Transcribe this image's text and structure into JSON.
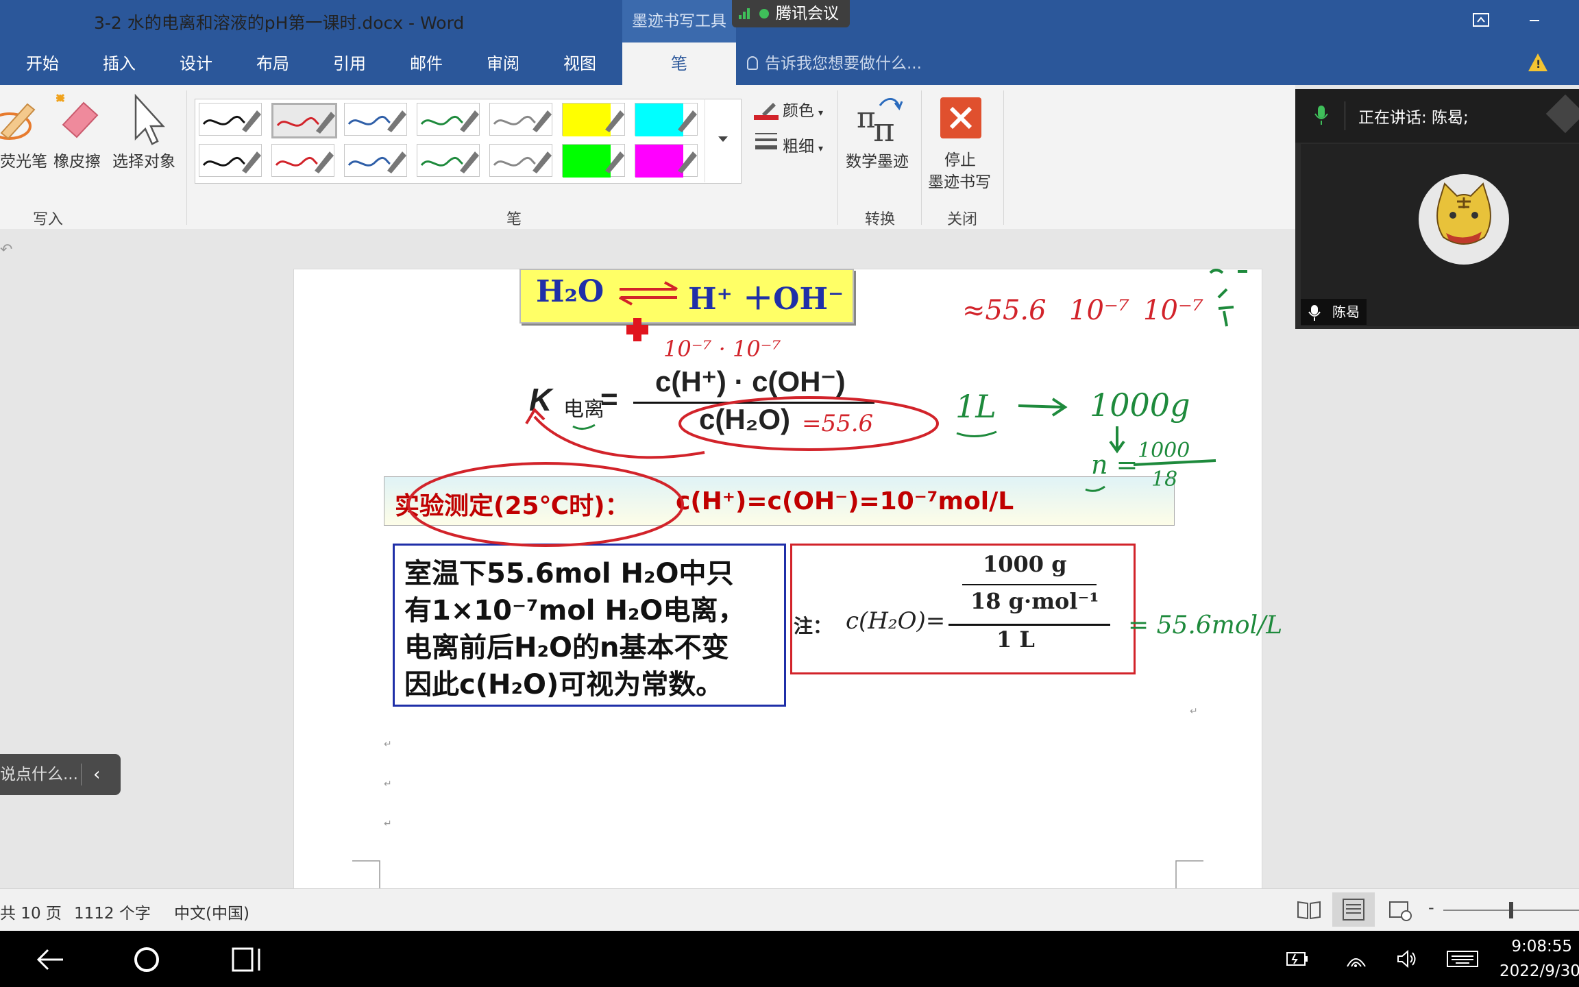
{
  "window": {
    "title": "3-2 水的电离和溶液的pH第一课时.docx - Word",
    "contextual_group": "墨迹书写工具",
    "meeting_app": "腾讯会议"
  },
  "tabs": [
    "开始",
    "插入",
    "设计",
    "布局",
    "引用",
    "邮件",
    "审阅",
    "视图",
    "笔"
  ],
  "active_tab": "笔",
  "tell_me": "告诉我您想要做什么...",
  "ribbon": {
    "groups": {
      "write": {
        "label": "写入",
        "highlighter": "荧光笔",
        "eraser": "橡皮擦",
        "select": "选择对象"
      },
      "pens": {
        "label": "笔",
        "color": "颜色",
        "thickness": "粗细"
      },
      "convert": {
        "label": "转换",
        "math_ink": "数学墨迹"
      },
      "close": {
        "label": "关闭",
        "stop_line1": "停止",
        "stop_line2": "墨迹书写"
      }
    },
    "pen_swatches": [
      {
        "color": "#111111",
        "kind": "pen"
      },
      {
        "color": "#d2232a",
        "kind": "pen"
      },
      {
        "color": "#2f5fa8",
        "kind": "pen"
      },
      {
        "color": "#1e8a3c",
        "kind": "pen"
      },
      {
        "color": "#888888",
        "kind": "pen"
      },
      {
        "color": "#ffff00",
        "kind": "highlighter"
      },
      {
        "color": "#00ffff",
        "kind": "highlighter"
      },
      {
        "color": "#111111",
        "kind": "pen"
      },
      {
        "color": "#d2232a",
        "kind": "pen"
      },
      {
        "color": "#2f5fa8",
        "kind": "pen"
      },
      {
        "color": "#1e8a3c",
        "kind": "pen"
      },
      {
        "color": "#888888",
        "kind": "pen"
      },
      {
        "color": "#00ff00",
        "kind": "highlighter"
      },
      {
        "color": "#ff00ff",
        "kind": "highlighter"
      }
    ],
    "selected_swatch": 1
  },
  "document": {
    "equilibrium": {
      "left": "H₂O",
      "right": "H⁺ ＋OH⁻"
    },
    "k_expression": {
      "symbol": "K",
      "subscript": "电离",
      "equals": "=",
      "numerator": "c(H⁺) · c(OH⁻)",
      "denominator": "c(H₂O)"
    },
    "experiment_label": "实验测定(25℃时)：",
    "experiment_eq": "c(H⁺)=c(OH⁻)=10⁻⁷mol/L",
    "text_lines": [
      "室温下55.6mol H₂O中只",
      "有1×10⁻⁷mol H₂O电离，",
      "电离前后H₂O的n基本不变",
      "因此c(H₂O)可视为常数。"
    ],
    "note": {
      "label": "注：",
      "lhs": "c(H₂O)=",
      "numerator_top": "1000 g",
      "numerator_bottom": "18 g·mol⁻¹",
      "denominator": "1 L"
    },
    "handwriting": {
      "top_right_row": [
        "≈55.6",
        "10⁻⁷",
        "10⁻⁷"
      ],
      "above_numerator": "10⁻⁷ · 10⁻⁷",
      "denominator_note": "=55.6",
      "liter": "1L",
      "grams": "1000g",
      "n_eq": "n =",
      "n_frac_top": "1000",
      "n_frac_bottom": "18",
      "note_result": "= 55.6mol/L"
    },
    "paragraph_mark": "↵"
  },
  "statusbar": {
    "pages": "共 10 页",
    "words": "1112 个字",
    "language": "中文(中国)",
    "zoom_level_fraction": 0.5
  },
  "meeting": {
    "speaking": "正在讲话: 陈曷;",
    "participant": "陈曷",
    "chat_placeholder": "说点什么..."
  },
  "system": {
    "time": "9:08:55",
    "date": "2022/9/30"
  },
  "colors": {
    "word_blue": "#2b579a",
    "ink_red": "#d2232a",
    "ink_green": "#1e8a3c",
    "highlight_yellow": "#ffff66"
  }
}
